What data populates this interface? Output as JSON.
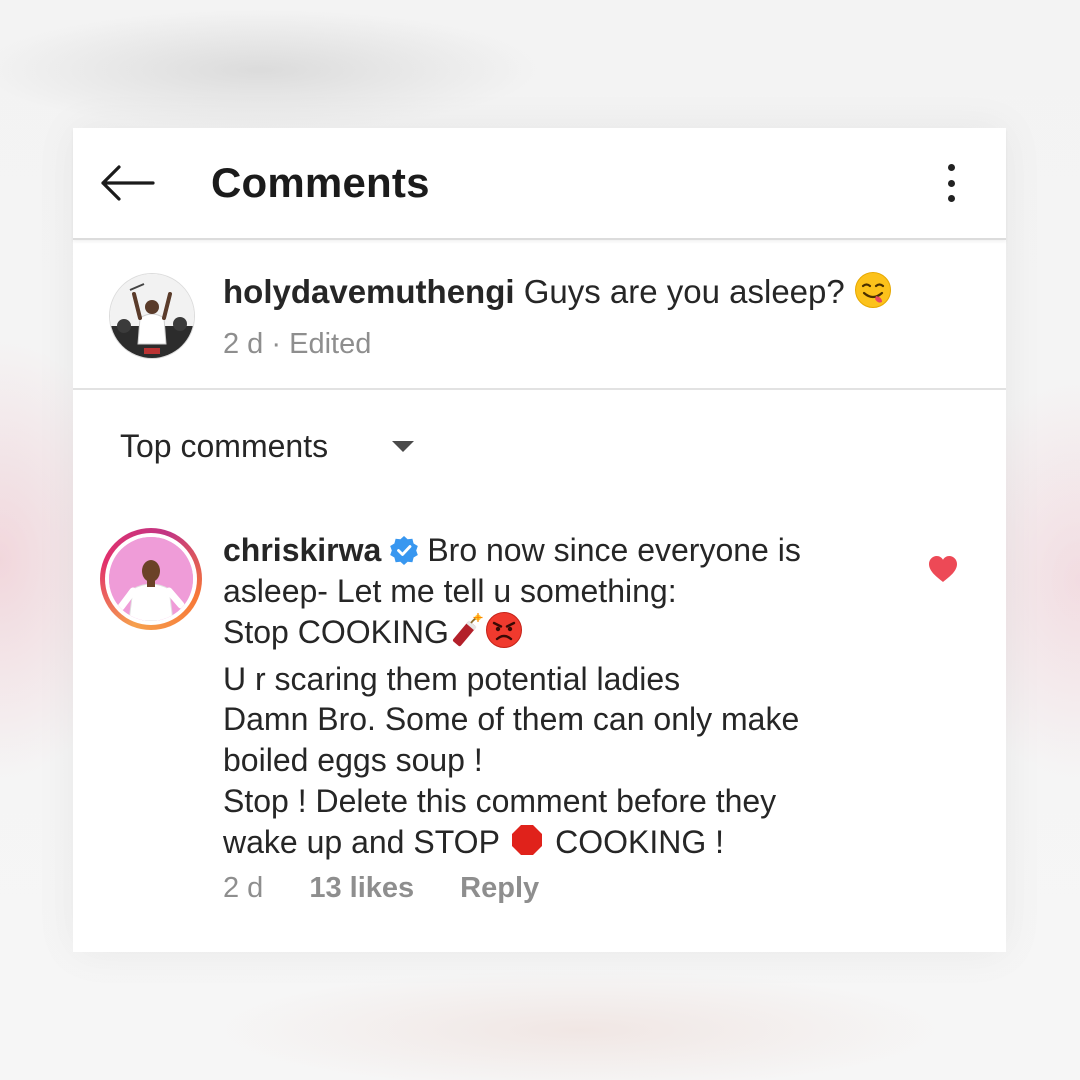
{
  "header": {
    "title": "Comments",
    "back_icon": "arrow-left-icon",
    "more_icon": "more-vertical-icon"
  },
  "caption": {
    "username": "holydavemuthengi",
    "text": "Guys are you asleep?",
    "emoji": "face-savoring-food-emoji",
    "time": "2 d",
    "separator": "·",
    "edited": "Edited"
  },
  "sort": {
    "label": "Top comments",
    "icon": "caret-down-icon"
  },
  "comment": {
    "username": "chriskirwa",
    "verified_icon": "verified-badge-icon",
    "lines": [
      "Bro now since everyone is",
      "asleep- Let me tell u something:",
      "Stop COOKING",
      "U r scaring them potential ladies",
      "Damn Bro. Some of them can only make",
      "boiled eggs soup !",
      "Stop ! Delete this comment before they",
      "wake up and STOP",
      "COOKING !"
    ],
    "emojis": [
      "firecracker-emoji",
      "angry-face-emoji",
      "stop-sign-emoji"
    ],
    "time": "2 d",
    "likes": "13 likes",
    "reply": "Reply",
    "liked": true,
    "like_icon": "heart-icon"
  },
  "colors": {
    "text": "#262626",
    "meta": "#8e8e8e",
    "heart": "#ed4956",
    "verified": "#3897f0",
    "story_ring": [
      "#f6a04d",
      "#e1306c",
      "#c13584"
    ]
  }
}
